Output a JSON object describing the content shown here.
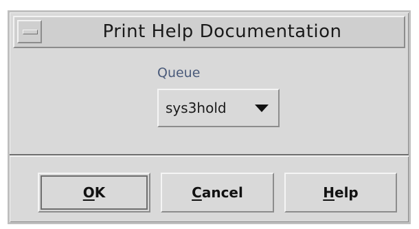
{
  "window": {
    "title": "Print Help Documentation"
  },
  "queue": {
    "label": "Queue",
    "selected": "sys3hold"
  },
  "buttons": {
    "ok": {
      "mnemonic": "O",
      "rest": "K"
    },
    "cancel": {
      "mnemonic": "C",
      "rest": "ancel"
    },
    "help": {
      "mnemonic": "H",
      "rest": "elp"
    }
  },
  "icons": {
    "window_menu": "window-menu-icon",
    "dropdown": "triangle-down-icon"
  },
  "colors": {
    "dialog_bg": "#d9d9d9",
    "label_text": "#4a5a7a"
  }
}
